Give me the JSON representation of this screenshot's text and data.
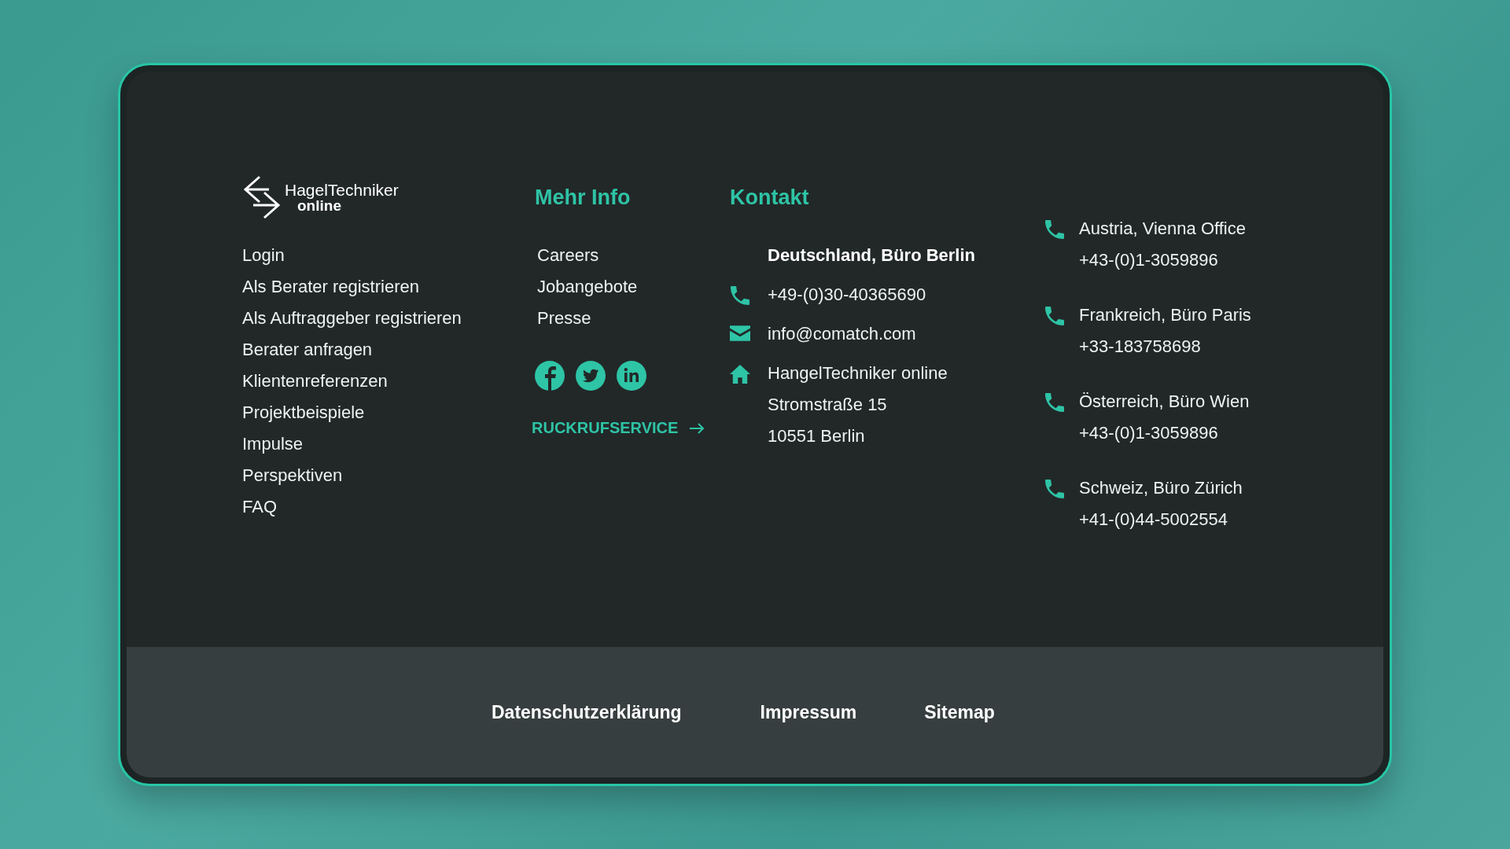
{
  "logo": {
    "name": "HagelTechniker",
    "sub": "online"
  },
  "nav_links": [
    "Login",
    "Als Berater registrieren",
    "Als Auftraggeber registrieren",
    "Berater anfragen",
    "Klientenreferenzen",
    "Projektbeispiele",
    "Impulse",
    "Perspektiven",
    "FAQ"
  ],
  "more_info": {
    "heading": "Mehr Info",
    "links": [
      "Careers",
      "Jobangebote",
      "Presse"
    ],
    "callback_link": "RUCKRUFSERVICE"
  },
  "contact": {
    "heading": "Kontakt",
    "office_title": "Deutschland, Büro Berlin",
    "items": [
      {
        "kind": "phone",
        "lines": [
          "+49-(0)30-40365690"
        ]
      },
      {
        "kind": "email",
        "lines": [
          "info@comatch.com"
        ]
      },
      {
        "kind": "address",
        "lines": [
          "HangelTechniker online",
          "Stromstraße 15",
          "10551 Berlin"
        ]
      }
    ]
  },
  "offices": [
    {
      "name": "Austria, Vienna Office",
      "phone": "+43-(0)1-3059896"
    },
    {
      "name": "Frankreich, Büro Paris",
      "phone": "+33-183758698"
    },
    {
      "name": "Österreich, Büro Wien",
      "phone": "+43-(0)1-3059896"
    },
    {
      "name": "Schweiz, Büro Zürich",
      "phone": "+41-(0)44-5002554"
    }
  ],
  "bottom_links": [
    "Datenschutzerklärung",
    "Impressum",
    "Sitemap"
  ]
}
